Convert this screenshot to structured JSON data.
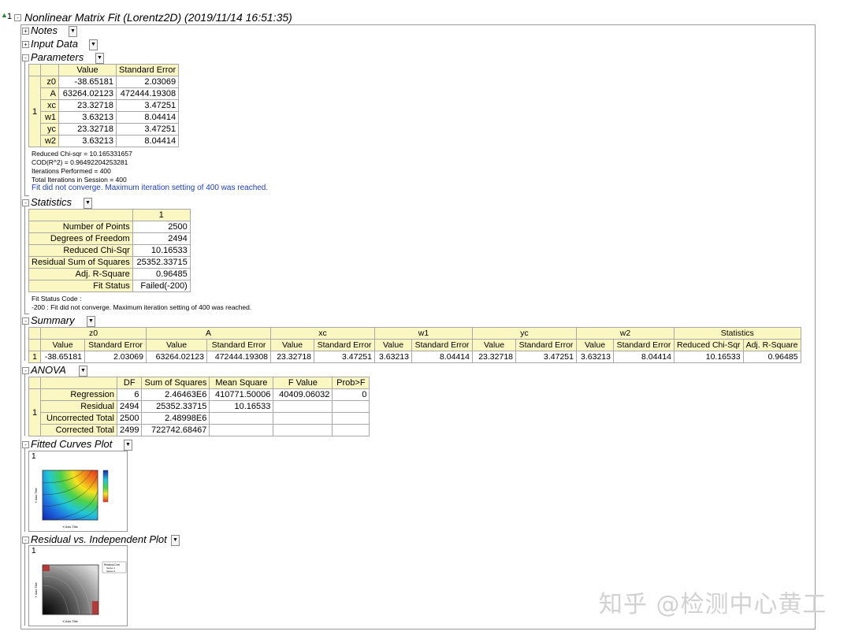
{
  "report": {
    "tree_index": "1",
    "title": "Nonlinear Matrix Fit (Lorentz2D) (2019/11/14 16:51:35)"
  },
  "sections": {
    "notes": "Notes",
    "input_data": "Input Data",
    "parameters": "Parameters",
    "statistics": "Statistics",
    "summary": "Summary",
    "anova": "ANOVA",
    "fitted_curves_plot": "Fitted Curves Plot",
    "residual_plot": "Residual vs. Independent Plot"
  },
  "parameters": {
    "headers": [
      "Value",
      "Standard Error"
    ],
    "group": "1",
    "rows": [
      {
        "name": "z0",
        "value": "-38.65181",
        "se": "2.03069"
      },
      {
        "name": "A",
        "value": "63264.02123",
        "se": "472444.19308"
      },
      {
        "name": "xc",
        "value": "23.32718",
        "se": "3.47251"
      },
      {
        "name": "w1",
        "value": "3.63213",
        "se": "8.04414"
      },
      {
        "name": "yc",
        "value": "23.32718",
        "se": "3.47251"
      },
      {
        "name": "w2",
        "value": "3.63213",
        "se": "8.04414"
      }
    ],
    "notes": [
      "Reduced Chi-sqr = 10.165331657",
      "COD(R^2) = 0.96492204253281",
      "Iterations Performed = 400",
      "Total Iterations in Session = 400"
    ],
    "warning": "Fit did not converge. Maximum iteration setting of 400 was reached."
  },
  "statistics": {
    "header": "1",
    "rows": [
      {
        "label": "Number of Points",
        "value": "2500"
      },
      {
        "label": "Degrees of Freedom",
        "value": "2494"
      },
      {
        "label": "Reduced Chi-Sqr",
        "value": "10.16533"
      },
      {
        "label": "Residual Sum of Squares",
        "value": "25352.33715"
      },
      {
        "label": "Adj. R-Square",
        "value": "0.96485"
      },
      {
        "label": "Fit Status",
        "value": "Failed(-200)"
      }
    ],
    "code_title": "Fit Status Code :",
    "code_line": "-200 : Fit did not converge. Maximum iteration setting of 400 was reached."
  },
  "summary": {
    "groups": [
      "z0",
      "A",
      "xc",
      "w1",
      "yc",
      "w2",
      "Statistics"
    ],
    "subheaders": [
      "Value",
      "Standard Error",
      "Value",
      "Standard Error",
      "Value",
      "Standard Error",
      "Value",
      "Standard Error",
      "Value",
      "Standard Error",
      "Value",
      "Standard Error",
      "Reduced Chi-Sqr",
      "Adj. R-Square"
    ],
    "row_label": "1",
    "row": [
      "-38.65181",
      "2.03069",
      "63264.02123",
      "472444.19308",
      "23.32718",
      "3.47251",
      "3.63213",
      "8.04414",
      "23.32718",
      "3.47251",
      "3.63213",
      "8.04414",
      "10.16533",
      "0.96485"
    ]
  },
  "anova": {
    "headers": [
      "DF",
      "Sum of Squares",
      "Mean Square",
      "F Value",
      "Prob>F"
    ],
    "group": "1",
    "rows": [
      {
        "label": "Regression",
        "df": "6",
        "ss": "2.46463E6",
        "ms": "410771.50006",
        "f": "40409.06032",
        "p": "0"
      },
      {
        "label": "Residual",
        "df": "2494",
        "ss": "25352.33715",
        "ms": "10.16533",
        "f": "",
        "p": ""
      },
      {
        "label": "Uncorrected Total",
        "df": "2500",
        "ss": "2.48998E6",
        "ms": "",
        "f": "",
        "p": ""
      },
      {
        "label": "Corrected Total",
        "df": "2499",
        "ss": "722742.68467",
        "ms": "",
        "f": "",
        "p": ""
      }
    ]
  },
  "plots": {
    "fitted_index": "1",
    "fitted_xlabel": "X Axis Title",
    "fitted_ylabel": "Y Axis Title",
    "residual_index": "1",
    "residual_xlabel": "X Axis Title",
    "residual_ylabel": "Y Axis Title",
    "residual_legend": [
      "Residual Cont",
      "Series 1",
      "Series 2"
    ]
  },
  "watermark": "知乎 @检测中心黄工"
}
